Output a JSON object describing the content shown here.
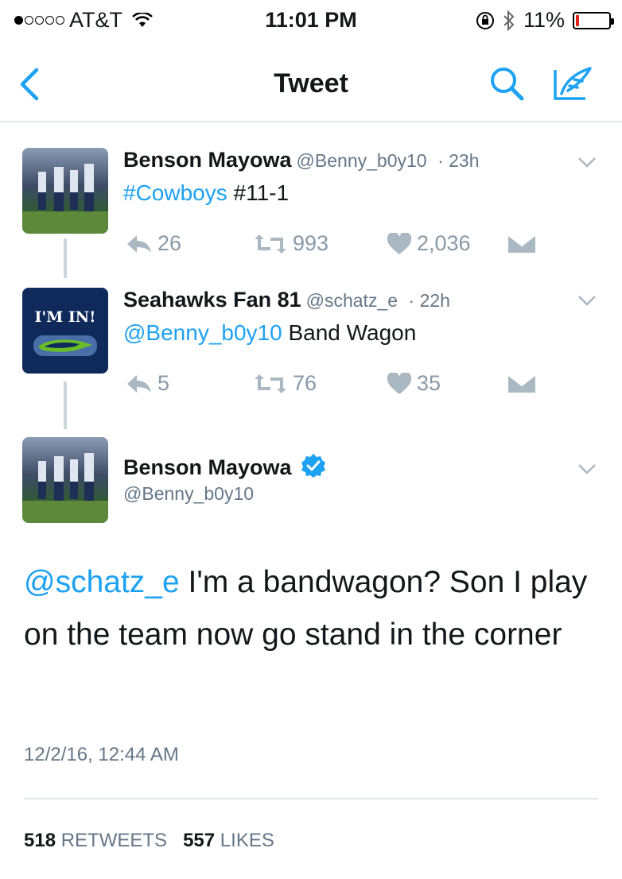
{
  "status_bar": {
    "carrier": "AT&T",
    "time": "11:01 PM",
    "battery": "11%",
    "battery_level": 0.11,
    "signal_bars_filled": 1,
    "signal_bars_total": 5
  },
  "nav": {
    "title": "Tweet",
    "accent_color": "#1da1f2"
  },
  "thread": [
    {
      "name": "Benson Mayowa",
      "handle": "@Benny_b0y10",
      "time": "· 23h",
      "text_parts": [
        "#Cowboys",
        " #11-1"
      ],
      "replies": "26",
      "retweets": "993",
      "likes": "2,036"
    },
    {
      "name": "Seahawks Fan 81",
      "handle": "@schatz_e",
      "time": "· 22h",
      "avatar_text": "I'M IN!",
      "text_parts": [
        "@Benny_b0y10",
        " Band Wagon"
      ],
      "replies": "5",
      "retweets": "76",
      "likes": "35"
    }
  ],
  "main_tweet": {
    "name": "Benson Mayowa",
    "handle": "@Benny_b0y10",
    "mention": "@schatz_e",
    "text": " I'm a bandwagon? Son I play on the team now go stand in the corner",
    "timestamp": "12/2/16, 12:44 AM",
    "retweets_count": "518",
    "retweets_label": "RETWEETS",
    "likes_count": "557",
    "likes_label": "LIKES"
  }
}
